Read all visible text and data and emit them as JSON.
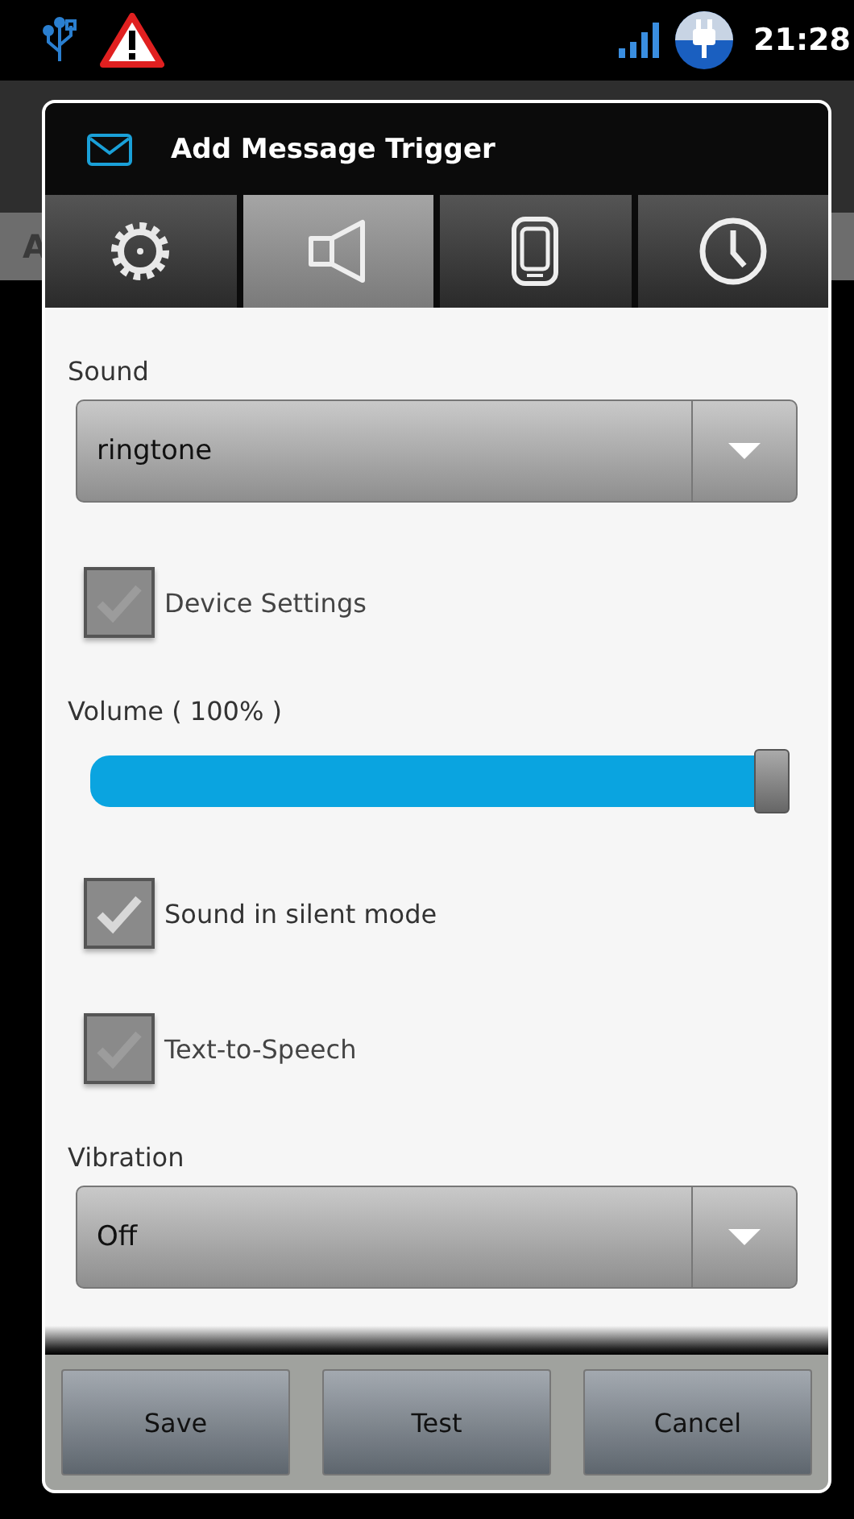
{
  "status_bar": {
    "time": "21:28"
  },
  "background": {
    "partial_label": "A"
  },
  "dialog": {
    "title": "Add Message Trigger",
    "tabs": [
      {
        "kind": "gear",
        "selected": false
      },
      {
        "kind": "speaker",
        "selected": true
      },
      {
        "kind": "phone",
        "selected": false
      },
      {
        "kind": "clock",
        "selected": false
      }
    ],
    "fields": [
      {
        "kind": "dropdown",
        "label": "Sound",
        "value": "ringtone"
      },
      {
        "kind": "checkbox",
        "label": "Device Settings",
        "checked": true,
        "disabled": true
      },
      {
        "kind": "slider",
        "label": "Volume ( 100% )",
        "level": 1
      },
      {
        "kind": "checkbox",
        "label": "Sound in silent mode",
        "checked": true,
        "disabled": false
      },
      {
        "kind": "checkbox",
        "label": "Text-to-Speech",
        "checked": true,
        "disabled": true
      },
      {
        "kind": "dropdown",
        "label": "Vibration",
        "value": "Off"
      }
    ],
    "buttons": [
      "Save",
      "Test",
      "Cancel"
    ]
  }
}
